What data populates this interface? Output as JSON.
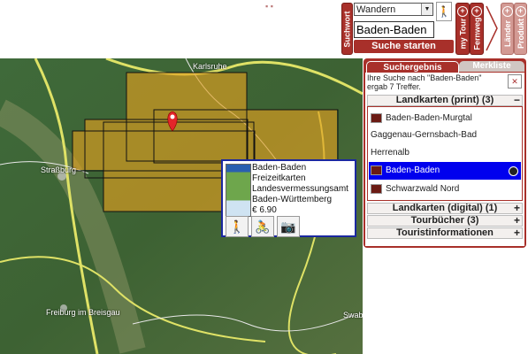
{
  "search": {
    "category": "Wandern",
    "query": "Baden-Baden",
    "button": "Suche starten",
    "tab_suchwort": "Suchwort",
    "tab_mytour": "my Tour",
    "tab_fernweg": "Fernweg",
    "tab_laender": "Länder",
    "tab_produkt": "Produkt"
  },
  "map": {
    "labels": {
      "karlsruhe": "Karlsruhe",
      "strasbourg": "Straßburg",
      "freiburg": "Freiburg im Breisgau",
      "swab": "Swab"
    }
  },
  "popup": {
    "lines": [
      "Baden-Baden",
      "Freizeitkarten",
      "Landesvermessungsamt",
      "Baden-Württemberg",
      "€ 6.90"
    ]
  },
  "results": {
    "tab_active": "Suchergebnis",
    "tab_inactive": "Merkliste",
    "message": "Ihre Suche nach \"Baden-Baden\" ergab 7 Treffer.",
    "groups": [
      {
        "label": "Landkarten (print) (3)",
        "icon": "−"
      },
      {
        "label": "Landkarten (digital) (1)",
        "icon": "+"
      },
      {
        "label": "Tourbücher (3)",
        "icon": "+"
      },
      {
        "label": "Touristinformationen",
        "icon": "+"
      }
    ],
    "items": [
      {
        "label": "Baden-Baden-Murgtal",
        "has_icon": true
      },
      {
        "label": "Gaggenau-Gernsbach-Bad",
        "has_icon": false
      },
      {
        "label": "Herrenalb",
        "has_icon": false
      },
      {
        "label": "Baden-Baden",
        "has_icon": true,
        "selected": true
      },
      {
        "label": "Schwarzwald Nord",
        "has_icon": true
      }
    ]
  },
  "colors": {
    "accent": "#a8302a",
    "selection": "#0000ee",
    "popup_border": "#1b28a0"
  }
}
